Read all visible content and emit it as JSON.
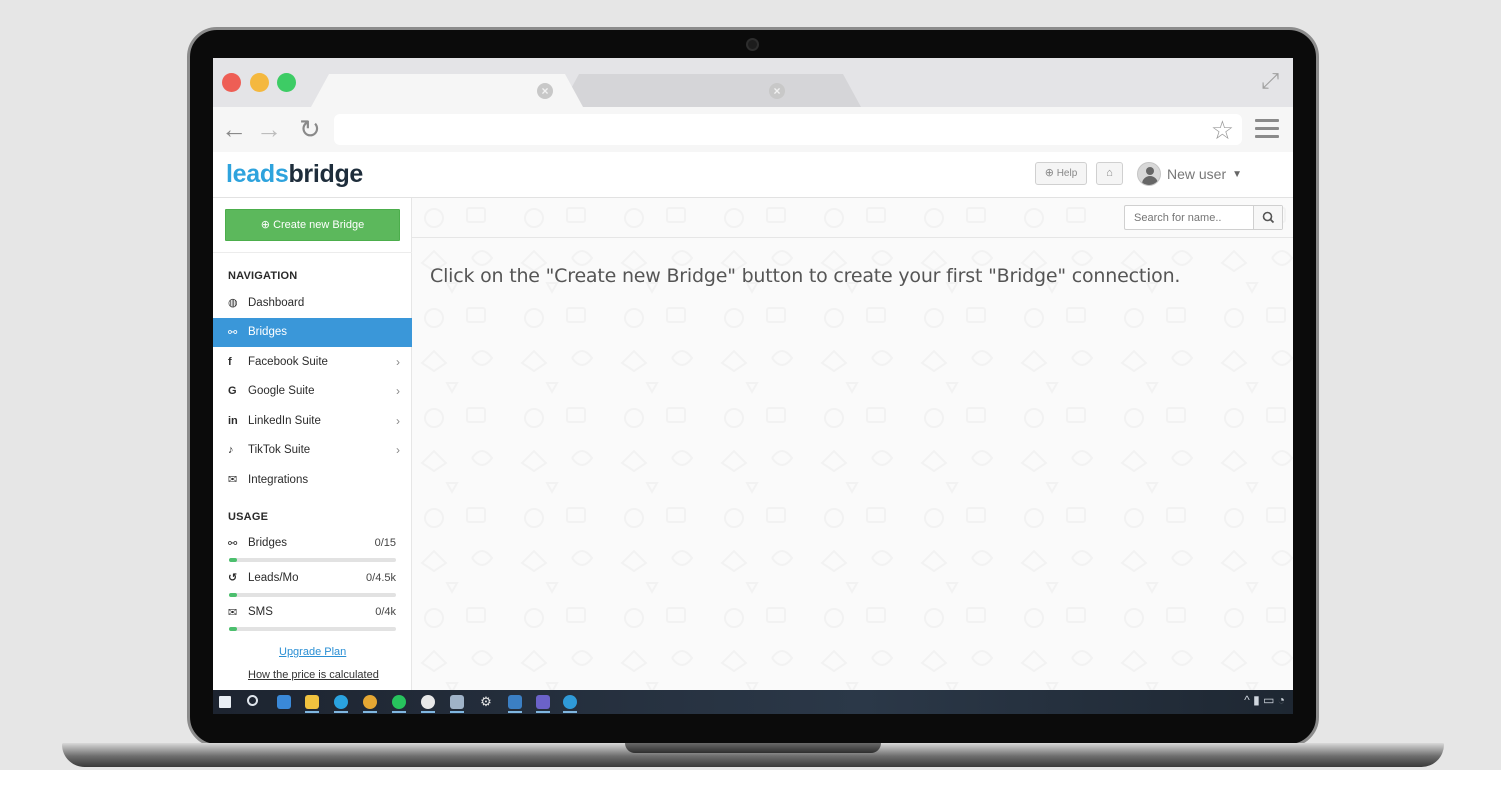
{
  "brand": {
    "leads": "leads",
    "bridge": "bridge"
  },
  "header": {
    "help_label": "Help",
    "user_name": "New user"
  },
  "sidebar": {
    "create_button": "Create new Bridge",
    "navigation_title": "NAVIGATION",
    "items": [
      {
        "label": "Dashboard",
        "icon": "dashboard-icon",
        "glyph": "◍",
        "active": false,
        "has_submenu": false
      },
      {
        "label": "Bridges",
        "icon": "bridges-icon",
        "glyph": "⚯",
        "active": true,
        "has_submenu": false
      },
      {
        "label": "Facebook Suite",
        "icon": "facebook-icon",
        "glyph": "f",
        "active": false,
        "has_submenu": true
      },
      {
        "label": "Google Suite",
        "icon": "google-icon",
        "glyph": "G",
        "active": false,
        "has_submenu": true
      },
      {
        "label": "LinkedIn Suite",
        "icon": "linkedin-icon",
        "glyph": "in",
        "active": false,
        "has_submenu": true
      },
      {
        "label": "TikTok Suite",
        "icon": "tiktok-icon",
        "glyph": "♪",
        "active": false,
        "has_submenu": true
      },
      {
        "label": "Integrations",
        "icon": "envelope-icon",
        "glyph": "✉",
        "active": false,
        "has_submenu": false
      }
    ],
    "usage_title": "USAGE",
    "usage": [
      {
        "label": "Bridges",
        "value": "0/15",
        "icon": "bridges-icon",
        "glyph": "⚯",
        "fill": 0.05
      },
      {
        "label": "Leads/Mo",
        "value": "0/4.5k",
        "icon": "history-icon",
        "glyph": "↺",
        "fill": 0.05
      },
      {
        "label": "SMS",
        "value": "0/4k",
        "icon": "envelope-icon",
        "glyph": "✉",
        "fill": 0.05
      }
    ],
    "upgrade_link": "Upgrade Plan",
    "price_link": "How the price is calculated"
  },
  "main": {
    "search_placeholder": "Search for name..",
    "empty_message": "Click on the \"Create new Bridge\" button to create your first \"Bridge\" connection."
  },
  "colors": {
    "brand_blue": "#2ea3dd",
    "brand_dark": "#1e2d3b",
    "active_nav": "#3a97d9",
    "create_green": "#5cb85c",
    "usage_green": "#4cbf6e"
  }
}
